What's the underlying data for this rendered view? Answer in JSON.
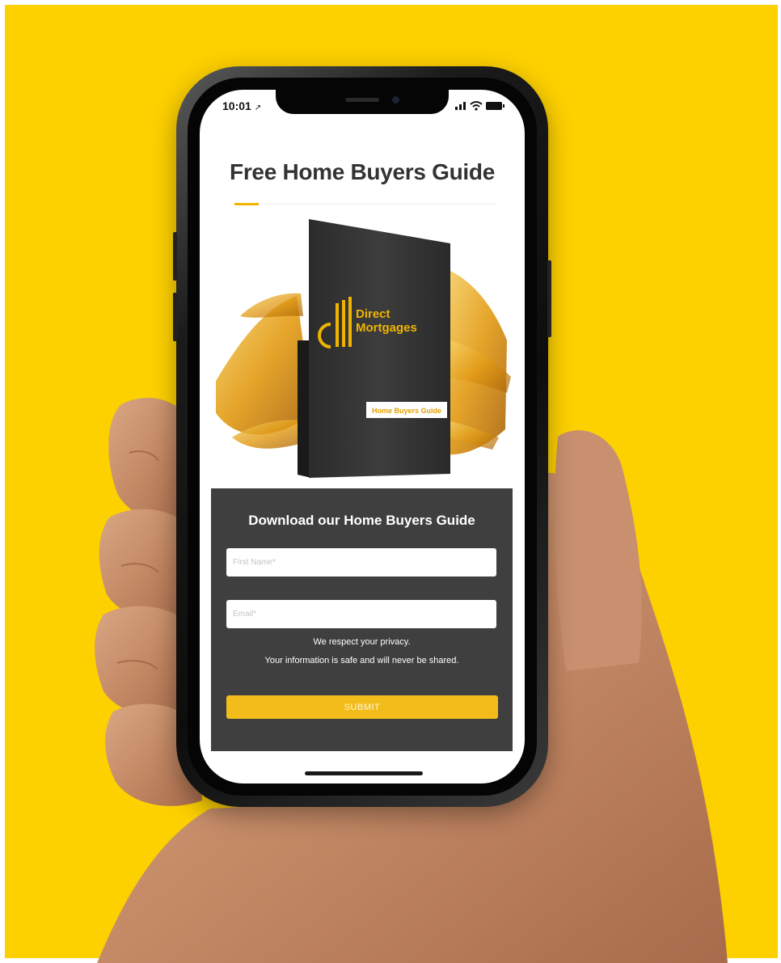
{
  "status_bar": {
    "time": "10:01"
  },
  "page": {
    "headline": "Free Home Buyers Guide"
  },
  "book": {
    "brand_line1": "Direct",
    "brand_line2": "Mortgages",
    "label": "Home Buyers Guide"
  },
  "form": {
    "title": "Download our Home Buyers Guide",
    "first_name_placeholder": "First Name*",
    "email_placeholder": "Email*",
    "privacy_line1": "We respect your privacy.",
    "privacy_line2": "Your information is safe and will never be shared.",
    "submit_label": "SUBMIT"
  },
  "colors": {
    "background": "#fdd000",
    "accent": "#f2bd1b",
    "panel": "#3f3f3f",
    "heading": "#333333"
  }
}
